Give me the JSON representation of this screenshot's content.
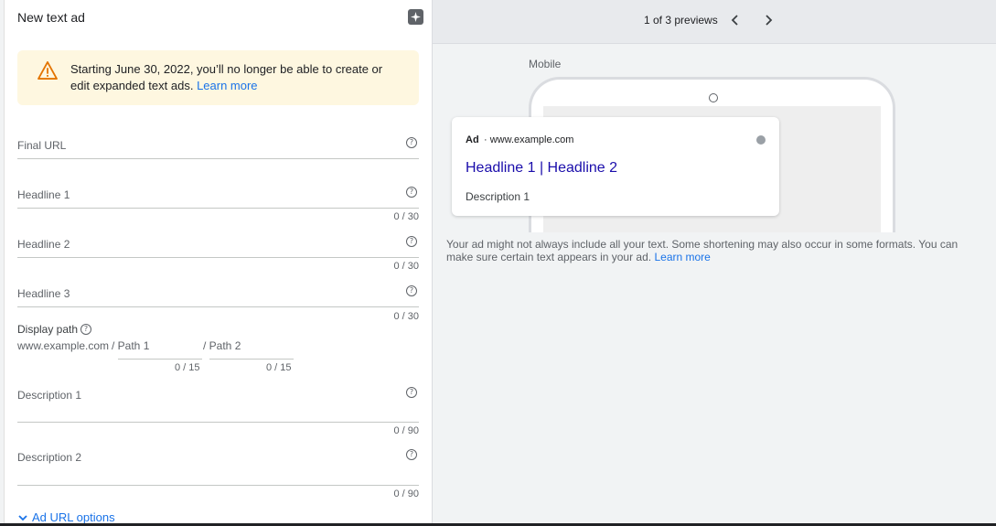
{
  "panel": {
    "title": "New text ad",
    "ai_icon": "sparkle-icon"
  },
  "notice": {
    "icon": "warning-icon",
    "text": "Starting June 30, 2022, you’ll no longer be able to create or edit expanded text ads.",
    "link": "Learn more"
  },
  "fields": {
    "final_url": {
      "label": "Final URL"
    },
    "headline1": {
      "label": "Headline 1",
      "counter": "0 / 30"
    },
    "headline2": {
      "label": "Headline 2",
      "counter": "0 / 30"
    },
    "headline3": {
      "label": "Headline 3",
      "counter": "0 / 30"
    },
    "description1": {
      "label": "Description 1",
      "counter": "0 / 90"
    },
    "description2": {
      "label": "Description 2",
      "counter": "0 / 90"
    }
  },
  "display_path": {
    "label": "Display path",
    "domain": "www.example.com",
    "path1_label": "/ Path 1",
    "path2_label": "/ Path 2",
    "path1_counter": "0 / 15",
    "path2_counter": "0 / 15"
  },
  "url_options": {
    "label": "Ad URL options"
  },
  "preview": {
    "count": "1 of 3 previews",
    "device_label": "Mobile",
    "ad_badge": "Ad",
    "ad_url": "· www.example.com",
    "ad_headline": "Headline 1 | Headline 2",
    "ad_description": "Description 1",
    "disclaimer": "Your ad might not always include all your text. Some shortening may also occur in some formats. You can make sure certain text appears in your ad.",
    "disclaimer_link": "Learn more"
  },
  "colors": {
    "accent": "#1a73e8",
    "headline": "#1a0dab",
    "notice_bg": "#fef7e0",
    "warning": "#e37400"
  }
}
